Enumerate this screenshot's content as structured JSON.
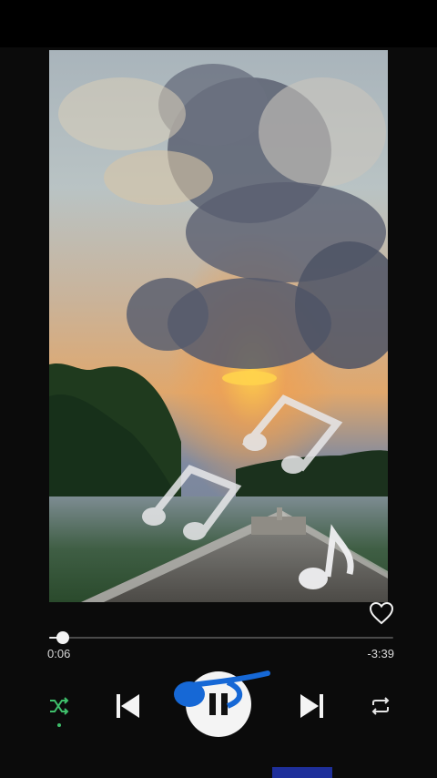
{
  "player": {
    "artwork_desc_icon": "album-artwork",
    "like_icon": "heart-outline-icon",
    "progress": {
      "fraction": 0.04
    },
    "elapsed": "0:06",
    "remaining": "-3:39",
    "controls": {
      "shuffle_icon": "shuffle-icon",
      "shuffle_active": true,
      "previous_icon": "skip-previous-icon",
      "play_pause_icon": "pause-icon",
      "next_icon": "skip-next-icon",
      "repeat_icon": "repeat-icon"
    }
  },
  "colors": {
    "background": "#0b0b0b",
    "accent_shuffle": "#3fbf6b",
    "overlay_blue": "#1668d6",
    "home_indicator": "#1e2f9a"
  }
}
